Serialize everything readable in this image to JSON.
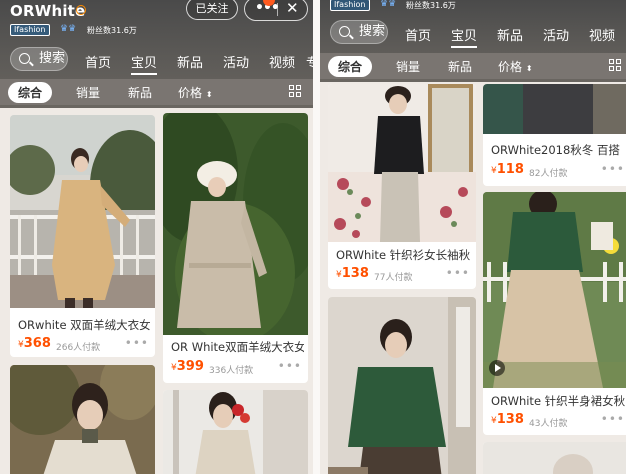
{
  "left": {
    "shop_name": "ORWhite",
    "brand_tag": "Ifashion",
    "fans": "粉丝数31.6万",
    "follow_label": "已关注",
    "more_dots": "•••",
    "close_glyph": "✕",
    "search_label": "搜索",
    "nav_tabs": [
      "首页",
      "宝贝",
      "新品",
      "活动",
      "视频",
      "专"
    ],
    "active_tab": "宝贝",
    "filters": [
      "综合",
      "销量",
      "新品",
      "价格"
    ],
    "sort_glyph": "⬍",
    "products": [
      {
        "title": "ORwhite 双面羊绒大衣女",
        "currency": "¥",
        "price": "368",
        "sold": "266人付款",
        "more": "•••"
      },
      {
        "title": "OR White双面羊绒大衣女",
        "currency": "¥",
        "price": "399",
        "sold": "336人付款",
        "more": "•••"
      },
      {
        "title": "",
        "price": "",
        "sold": ""
      },
      {
        "title": "",
        "price": "",
        "sold": ""
      }
    ]
  },
  "right": {
    "brand_tag": "Ifashion",
    "fans": "粉丝数31.6万",
    "search_label": "搜索",
    "nav_tabs": [
      "首页",
      "宝贝",
      "新品",
      "活动",
      "视频"
    ],
    "active_tab": "宝贝",
    "filters": [
      "综合",
      "销量",
      "新品",
      "价格"
    ],
    "sort_glyph": "⬍",
    "products": [
      {
        "title": "ORWhite 针织衫女长袖秋",
        "currency": "¥",
        "price": "138",
        "sold": "77人付款",
        "more": "•••"
      },
      {
        "title": "ORWhite2018秋冬 百搭",
        "currency": "¥",
        "price": "118",
        "sold": "82人付款",
        "more": "•••"
      },
      {
        "title": "",
        "price": "",
        "sold": ""
      },
      {
        "title": "ORWhite 针织半身裙女秋",
        "currency": "¥",
        "price": "138",
        "sold": "43人付款",
        "more": "•••"
      },
      {
        "title": "",
        "price": "",
        "sold": ""
      }
    ]
  },
  "colors": {
    "accent": "#ff5000",
    "header": "#5b5956",
    "filterbar": "#7a7571"
  },
  "icons": [
    "verify-icon",
    "tmall-icon",
    "search-icon",
    "more-icon",
    "close-icon",
    "grid-view-icon",
    "play-icon",
    "notification-dot"
  ]
}
